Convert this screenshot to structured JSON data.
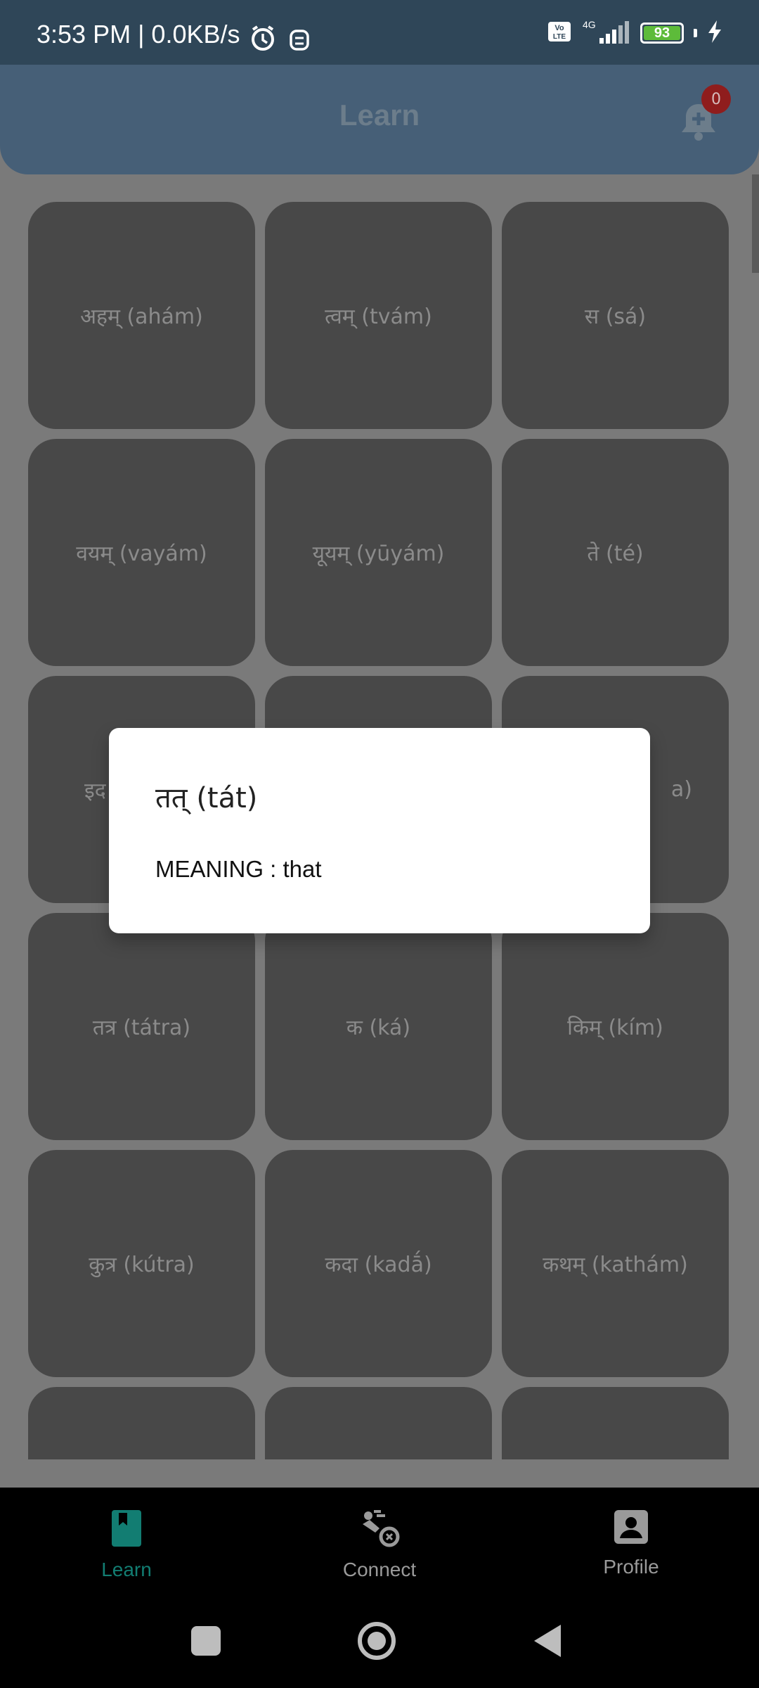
{
  "status_bar": {
    "time": "3:53 PM | 0.0KB/s",
    "network_label": "4G",
    "volte_label": "Vo LTE",
    "battery_level": "93"
  },
  "app_bar": {
    "title": "Learn",
    "notification_count": "0"
  },
  "grid": {
    "items": [
      "अहम् (ahám)",
      "त्वम् (tvám)",
      "स (sá)",
      "वयम् (vayám)",
      "यूयम् (yūyám)",
      "ते (té)",
      "इद",
      "",
      "a)",
      "तत्र (tátra)",
      "क (ká)",
      "किम् (kím)",
      "कुत्र (kútra)",
      "कदा (kadā́)",
      "कथम् (kathám)",
      "",
      "",
      ""
    ]
  },
  "dialog": {
    "title": "तत् (tát)",
    "meaning": "MEANING : that"
  },
  "bottom_nav": {
    "items": [
      {
        "label": "Learn"
      },
      {
        "label": "Connect"
      },
      {
        "label": "Profile"
      }
    ]
  },
  "colors": {
    "accent": "#127d72",
    "appbar": "#465f77",
    "statusbar": "#2f4658",
    "cell": "#484848"
  }
}
